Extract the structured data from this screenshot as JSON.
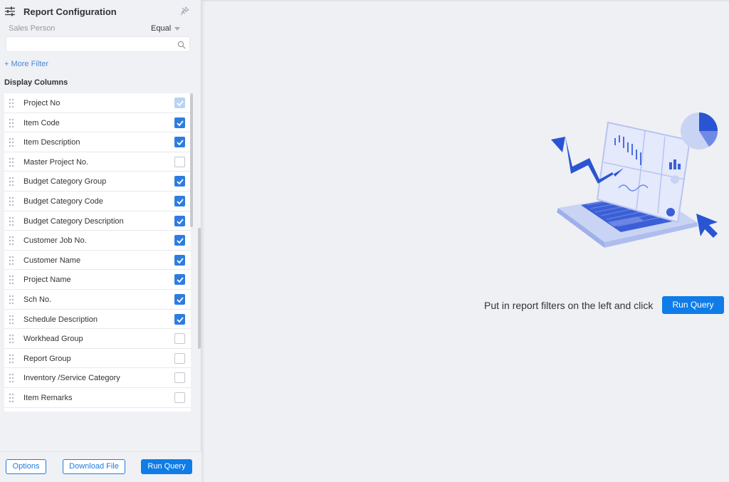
{
  "sidebar": {
    "title": "Report Configuration",
    "filter": {
      "field_label": "Sales Person",
      "operator": "Equal",
      "search_value": "",
      "search_placeholder": ""
    },
    "more_filter_label": "+ More Filter",
    "display_columns_title": "Display Columns",
    "columns": [
      {
        "label": "Project No",
        "checked": true,
        "disabled": true
      },
      {
        "label": "Item Code",
        "checked": true,
        "disabled": false
      },
      {
        "label": "Item Description",
        "checked": true,
        "disabled": false
      },
      {
        "label": "Master Project No.",
        "checked": false,
        "disabled": false
      },
      {
        "label": "Budget Category Group",
        "checked": true,
        "disabled": false
      },
      {
        "label": "Budget Category Code",
        "checked": true,
        "disabled": false
      },
      {
        "label": "Budget Category Description",
        "checked": true,
        "disabled": false
      },
      {
        "label": "Customer Job No.",
        "checked": true,
        "disabled": false
      },
      {
        "label": "Customer Name",
        "checked": true,
        "disabled": false
      },
      {
        "label": "Project Name",
        "checked": true,
        "disabled": false
      },
      {
        "label": "Sch No.",
        "checked": true,
        "disabled": false
      },
      {
        "label": "Schedule Description",
        "checked": true,
        "disabled": false
      },
      {
        "label": "Workhead Group",
        "checked": false,
        "disabled": false
      },
      {
        "label": "Report Group",
        "checked": false,
        "disabled": false
      },
      {
        "label": "Inventory /Service Category",
        "checked": false,
        "disabled": false
      },
      {
        "label": "Item Remarks",
        "checked": false,
        "disabled": false
      }
    ],
    "footer": {
      "options_label": "Options",
      "download_label": "Download File",
      "run_label": "Run Query"
    }
  },
  "main": {
    "prompt_text": "Put in report filters on the left and click",
    "run_label": "Run Query"
  },
  "colors": {
    "accent": "#0f7ce8",
    "checkbox_checked": "#2f7ce0",
    "checkbox_disabled": "#b9d3f3",
    "link": "#4a86d6",
    "background": "#eff0f4"
  },
  "icons": {
    "config": "sliders-icon",
    "pin": "pin-icon",
    "search": "search-icon",
    "drag": "drag-handle-icon",
    "check": "check-icon"
  }
}
